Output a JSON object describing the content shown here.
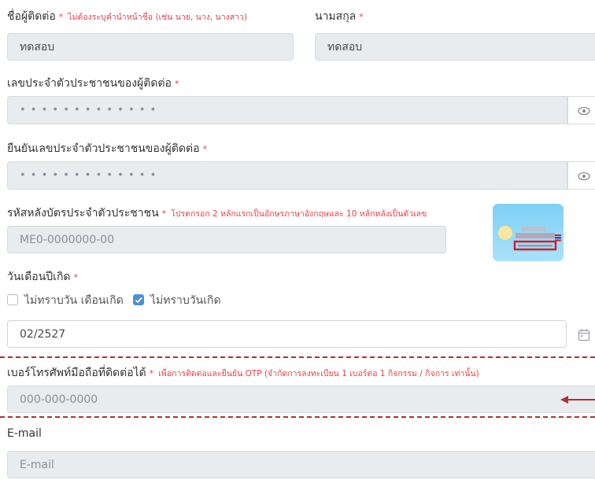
{
  "contact": {
    "first_name_label": "ชื่อผู้ติดต่อ",
    "first_name_note": "ไม่ต้องระบุคำนำหน้าชื่อ (เช่น นาย, นาง, นางสาว)",
    "first_name_value": "ทดสอบ",
    "last_name_label": "นามสกุล",
    "last_name_value": "ทดสอบ",
    "required_mark": "*"
  },
  "id_card": {
    "label": "เลขประจำตัวประชาชนของผู้ติดต่อ",
    "masked_value": "• • • • • • • • • • • • •",
    "confirm_label": "ยืนยันเลขประจำตัวประชาชนของผู้ติดต่อ",
    "confirm_masked_value": "• • • • • • • • • • • • •"
  },
  "laser_code": {
    "label": "รหัสหลังบัตรประจำตัวประชาชน",
    "note": "โปรดกรอก 2 หลักแรกเป็นอักษรภาษาอังกฤษและ 10 หลักหลังเป็นตัวเลข",
    "placeholder": "ME0-0000000-00"
  },
  "birth": {
    "label": "วันเดือนปีเกิด",
    "unknown_day_month_label": "ไม่ทราบวัน เดือนเกิด",
    "unknown_day_month_checked": false,
    "unknown_day_label": "ไม่ทราบวันเกิด",
    "unknown_day_checked": true,
    "value": "02/2527"
  },
  "phone": {
    "label": "เบอร์โทรศัพท์มือถือที่ติดต่อได้",
    "note": "เพื่อการติดต่อและยืนยัน OTP (จำกัดการลงทะเบียน 1 เบอร์ต่อ 1 กิจกรรม / กิจการ เท่านั้น)",
    "placeholder": "000-000-0000"
  },
  "email": {
    "label": "E-mail",
    "placeholder": "E-mail"
  },
  "colors": {
    "field_bg": "#e9ecef",
    "required": "#e0434e",
    "highlight": "#b03030",
    "checkbox": "#4a90d9"
  }
}
